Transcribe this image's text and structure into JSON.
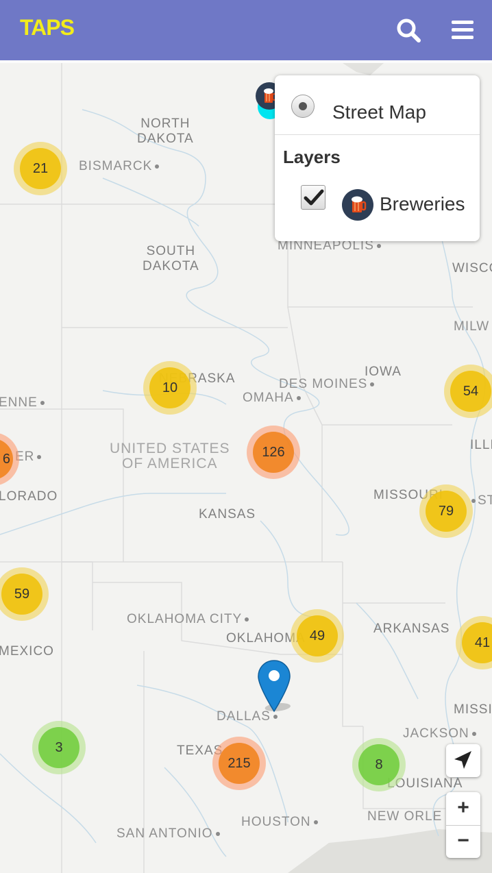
{
  "app": {
    "brand": "TAPS"
  },
  "header": {
    "search_icon": "search-icon",
    "menu_icon": "hamburger-menu-icon"
  },
  "layer_control": {
    "base_layer_label": "Street Map",
    "base_layer_selected": true,
    "overlays_title": "Layers",
    "overlay_label": "Breweries",
    "overlay_checked": true
  },
  "map": {
    "state_labels": {
      "north_dakota": "NORTH\nDAKOTA",
      "south_dakota": "SOUTH\nDAKOTA",
      "nebraska": "NEBRASKA",
      "kansas": "KANSAS",
      "oklahoma": "OKLAHOMA",
      "texas": "TEXAS",
      "iowa": "IOWA",
      "missouri": "MISSOURI",
      "arkansas": "ARKANSAS",
      "louisiana": "LOUISIANA",
      "colorado": "LORADO",
      "new_mexico": "MEXICO",
      "wisconsin": "WISCO",
      "illinois": "ILLI",
      "mississippi": "MISSIS"
    },
    "country_label": "UNITED STATES\nOF AMERICA",
    "city_labels": {
      "bismarck": "BISMARCK",
      "minneapolis": "MINNEAPOLIS",
      "omaha": "OMAHA",
      "des_moines": "DES MOINES",
      "oklahoma_city": "OKLAHOMA CITY",
      "dallas": "DALLAS",
      "houston": "HOUSTON",
      "san_antonio": "SAN ANTONIO",
      "jackson": "JACKSON",
      "new_orleans": "NEW ORLE",
      "cheyenne": "ENNE",
      "denver": "ER",
      "milwaukee": "MILW",
      "st_louis": "ST"
    },
    "clusters": {
      "c21": "21",
      "c10": "10",
      "c126": "126",
      "c54": "54",
      "c79": "79",
      "c59": "59",
      "c49": "49",
      "c41": "41",
      "c3": "3",
      "c215": "215",
      "c8": "8",
      "c6": "6"
    },
    "cluster_colors": {
      "small": "#6ecc39",
      "medium": "#f0c20c",
      "large": "#f18017"
    }
  },
  "controls": {
    "locate_icon": "locate-arrow-icon",
    "zoom_in": "+",
    "zoom_out": "−"
  }
}
